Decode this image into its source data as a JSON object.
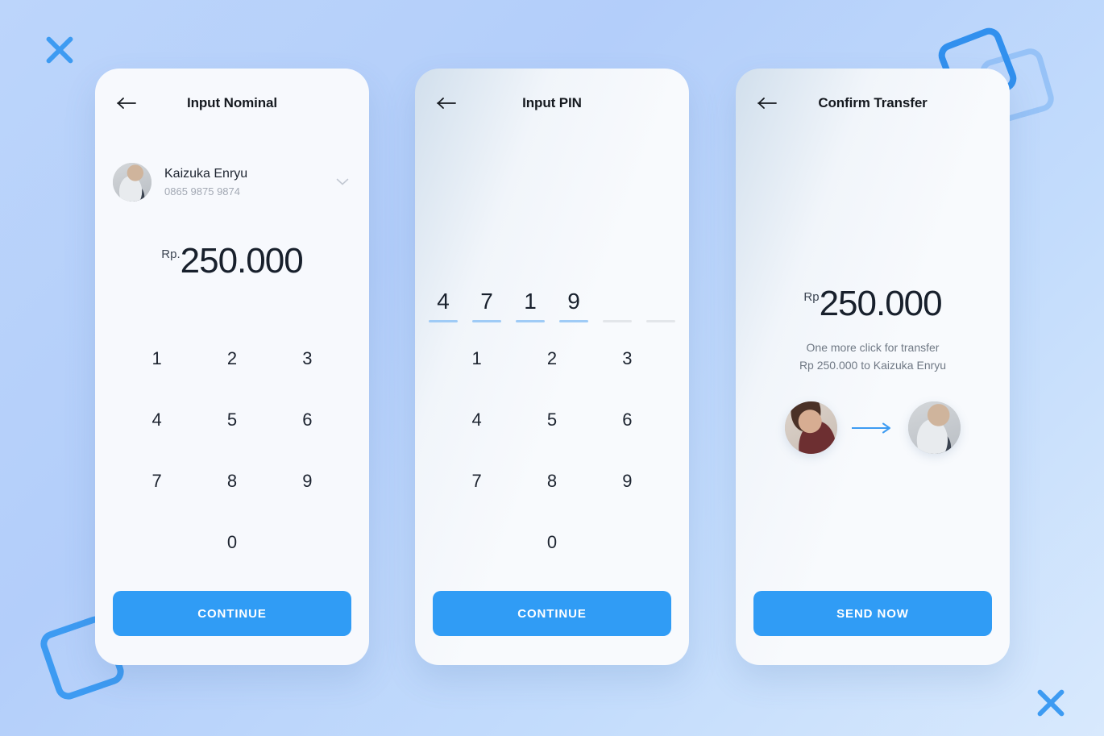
{
  "theme": {
    "accent": "#309cf5",
    "accent_deco": "#3d9bf2",
    "background": "#b3cefa",
    "card_background": "#f7f9fd",
    "text_primary": "#18202c",
    "text_muted": "#a3a9b4",
    "pin_filled": "#9fcbf6",
    "pin_empty": "#e3e6ea"
  },
  "decorations": {
    "x_top_left": "close-x-mark",
    "x_bottom_right": "close-x-mark",
    "square_top_right_solid": "rotated-square-outline",
    "square_top_right_light": "rotated-square-outline",
    "square_bottom_left": "rotated-square-outline"
  },
  "keypad": {
    "keys": [
      "1",
      "2",
      "3",
      "4",
      "5",
      "6",
      "7",
      "8",
      "9",
      "",
      "0",
      ""
    ]
  },
  "card1": {
    "title": "Input Nominal",
    "back_icon": "arrow-left-icon",
    "contact": {
      "name": "Kaizuka Enryu",
      "phone": "0865 9875 9874",
      "avatar": "contact-avatar",
      "chevron_icon": "chevron-down-icon"
    },
    "amount": {
      "currency": "Rp.",
      "value": "250.000"
    },
    "button_label": "CONTINUE"
  },
  "card2": {
    "title": "Input PIN",
    "back_icon": "arrow-left-icon",
    "pin": {
      "length": 6,
      "digits": [
        "4",
        "7",
        "1",
        "9",
        "",
        ""
      ]
    },
    "button_label": "CONTINUE"
  },
  "card3": {
    "title": "Confirm Transfer",
    "back_icon": "arrow-left-icon",
    "amount": {
      "currency": "Rp",
      "value": "250.000"
    },
    "note_line1": "One more click for transfer",
    "note_line2": "Rp 250.000 to Kaizuka Enryu",
    "transfer": {
      "sender_avatar": "sender-avatar",
      "arrow_icon": "arrow-right-icon",
      "recipient_avatar": "recipient-avatar"
    },
    "button_label": "SEND NOW"
  }
}
